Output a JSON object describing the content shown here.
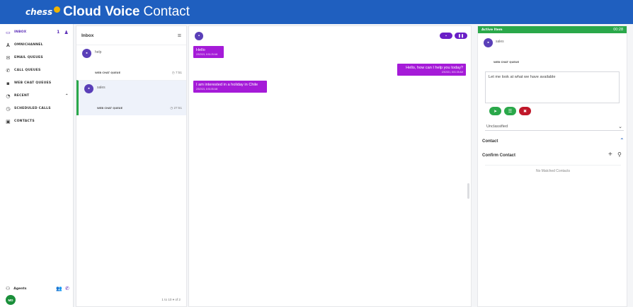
{
  "topbar": {
    "brand_small": "chess",
    "brand_big": "Cloud Voice",
    "brand_light": "Contact"
  },
  "nav": {
    "items": [
      {
        "label": "Inbox",
        "badge": "1",
        "icon": "inbox-icon"
      },
      {
        "label": "Omnichannel",
        "icon": "omnichannel-icon"
      },
      {
        "label": "Email Queues",
        "icon": "email-icon"
      },
      {
        "label": "Call Queues",
        "icon": "phone-icon"
      },
      {
        "label": "Web Chat Queues",
        "icon": "chat-icon"
      },
      {
        "label": "Recent",
        "icon": "recent-icon"
      },
      {
        "label": "Scheduled Calls",
        "icon": "clock-icon"
      },
      {
        "label": "Contacts",
        "icon": "contacts-icon"
      }
    ],
    "agents_label": "Agents",
    "avatar_initials": "MD"
  },
  "inbox": {
    "title": "Inbox",
    "conversations": [
      {
        "name": "help",
        "tag": "WEB CHAT QUEUE",
        "time": "7:51"
      },
      {
        "name": "sales",
        "tag": "WEB CHAT QUEUE",
        "time": "27:51"
      }
    ],
    "footer": "1 to 10 ▾ of 2"
  },
  "chat": {
    "messages": [
      {
        "text": "Hello",
        "timestamp": "2/3/2021, 8:51:25 AM"
      },
      {
        "text": "Hello, how can I help you today?",
        "timestamp": "2/3/2021, 8:51:35 AM"
      },
      {
        "text": "I am interested in a holiday in Chile",
        "timestamp": "2/3/2021, 8:51:55 AM"
      }
    ]
  },
  "right": {
    "title": "Active Item",
    "timer": "00:28",
    "contact_name": "sales",
    "tag": "WEB CHAT QUEUE",
    "reply_text": "Let me look at what we have available",
    "classification": "Unclassified",
    "contact_section": "Contact",
    "confirm_section": "Confirm Contact",
    "no_match": "No Matched Contacts"
  },
  "colors": {
    "brand": "#1f5fbf",
    "accent": "#a51bd8",
    "success": "#2aa84a",
    "danger": "#c0182a"
  }
}
